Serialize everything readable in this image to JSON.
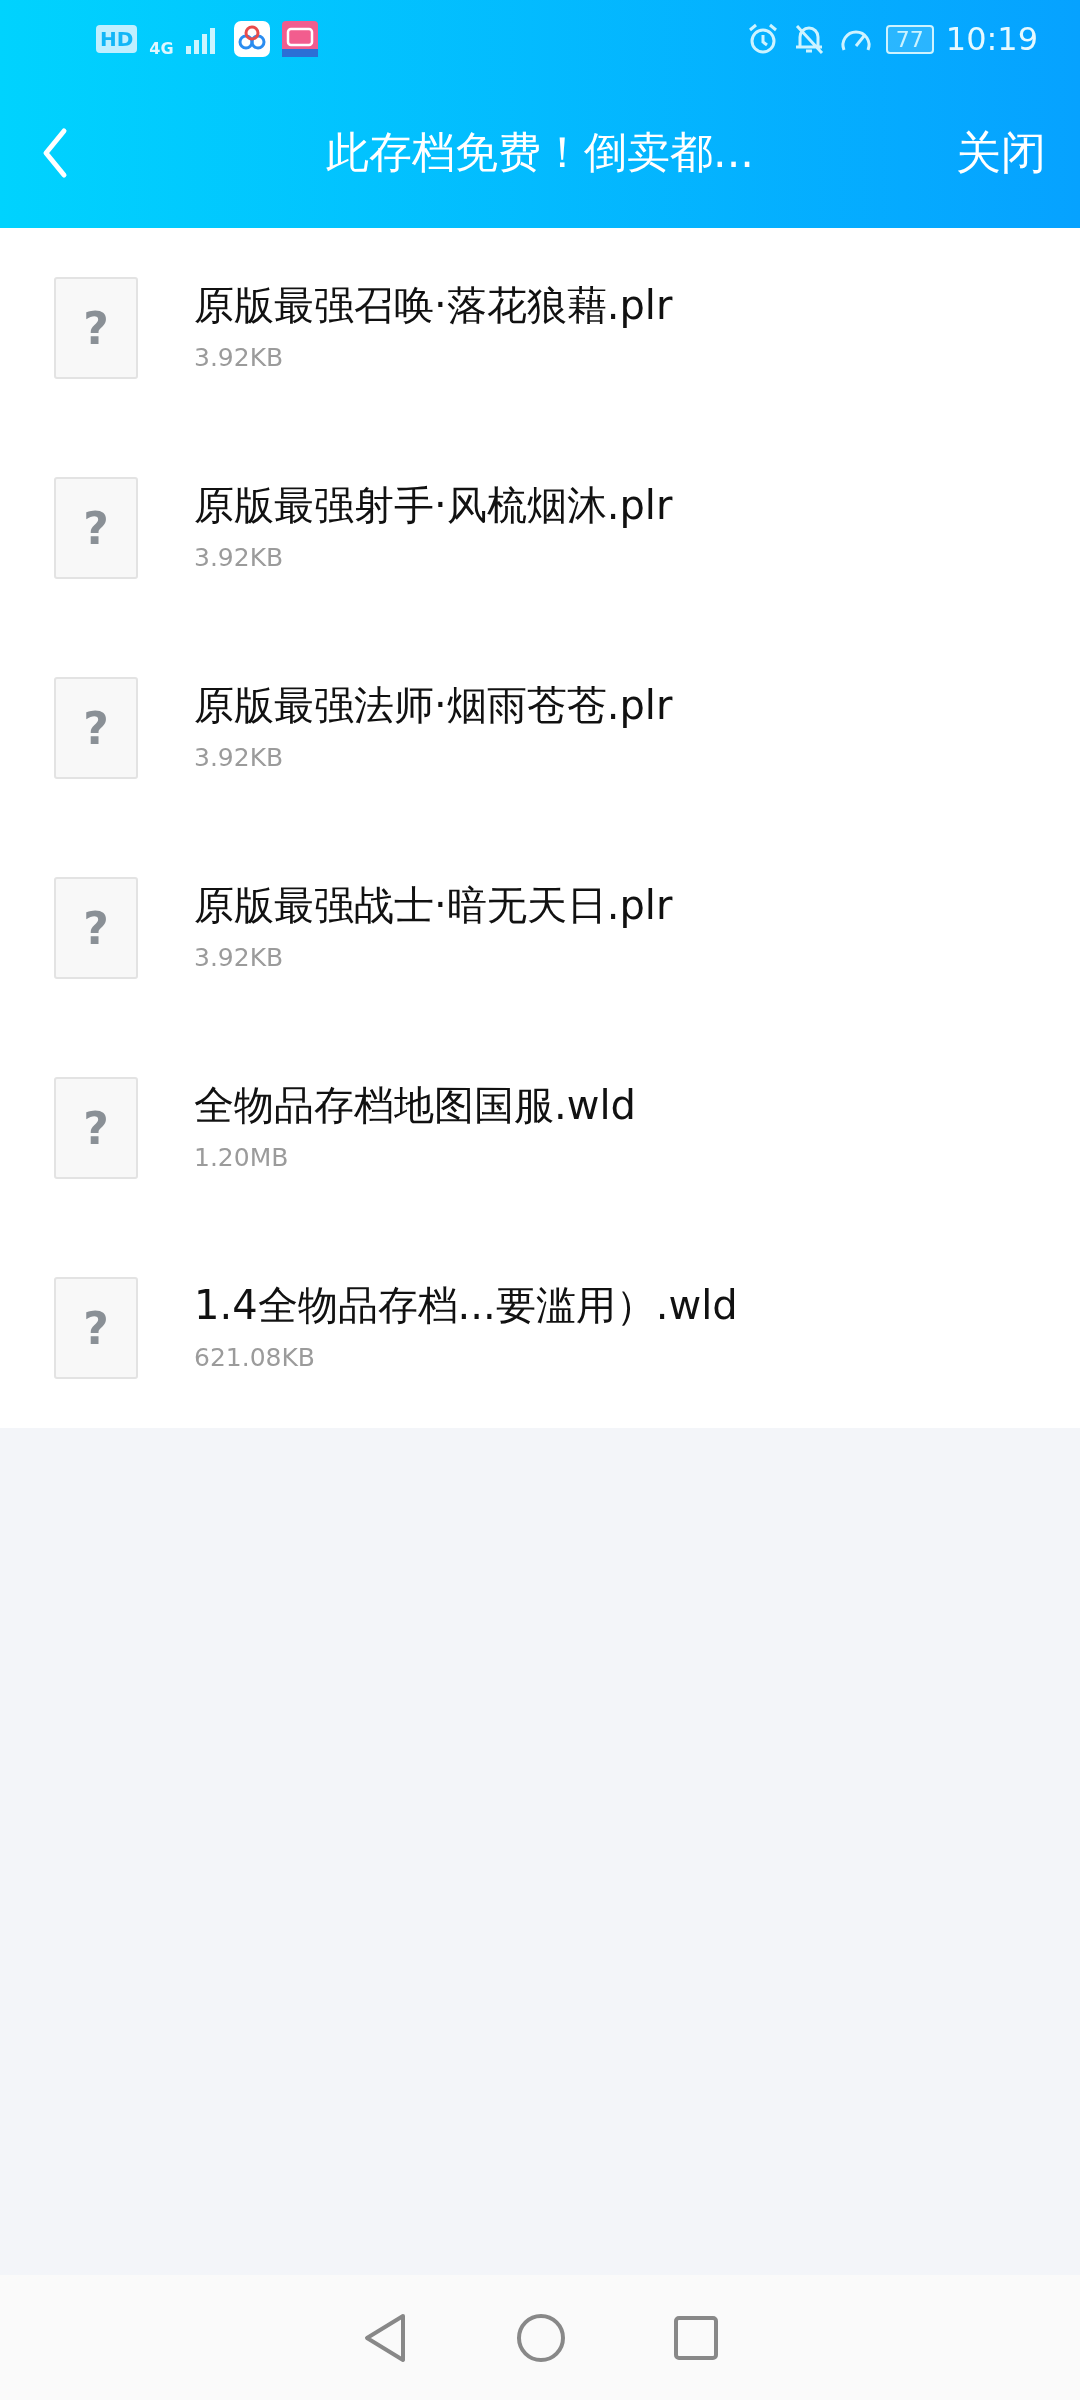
{
  "status_bar": {
    "hd": "HD",
    "network": "4G",
    "battery": "77",
    "time": "10:19"
  },
  "header": {
    "title": "此存档免费！倒卖都...",
    "close": "关闭"
  },
  "files": [
    {
      "name": "原版最强召唤·落花狼藉.plr",
      "size": "3.92KB",
      "glyph": "?"
    },
    {
      "name": "原版最强射手·风梳烟沐.plr",
      "size": "3.92KB",
      "glyph": "?"
    },
    {
      "name": "原版最强法师·烟雨苍苍.plr",
      "size": "3.92KB",
      "glyph": "?"
    },
    {
      "name": "原版最强战士·暗无天日.plr",
      "size": "3.92KB",
      "glyph": "?"
    },
    {
      "name": "全物品存档地图国服.wld",
      "size": "1.20MB",
      "glyph": "?"
    },
    {
      "name": "1.4全物品存档...要滥用）.wld",
      "size": "621.08KB",
      "glyph": "?"
    }
  ]
}
